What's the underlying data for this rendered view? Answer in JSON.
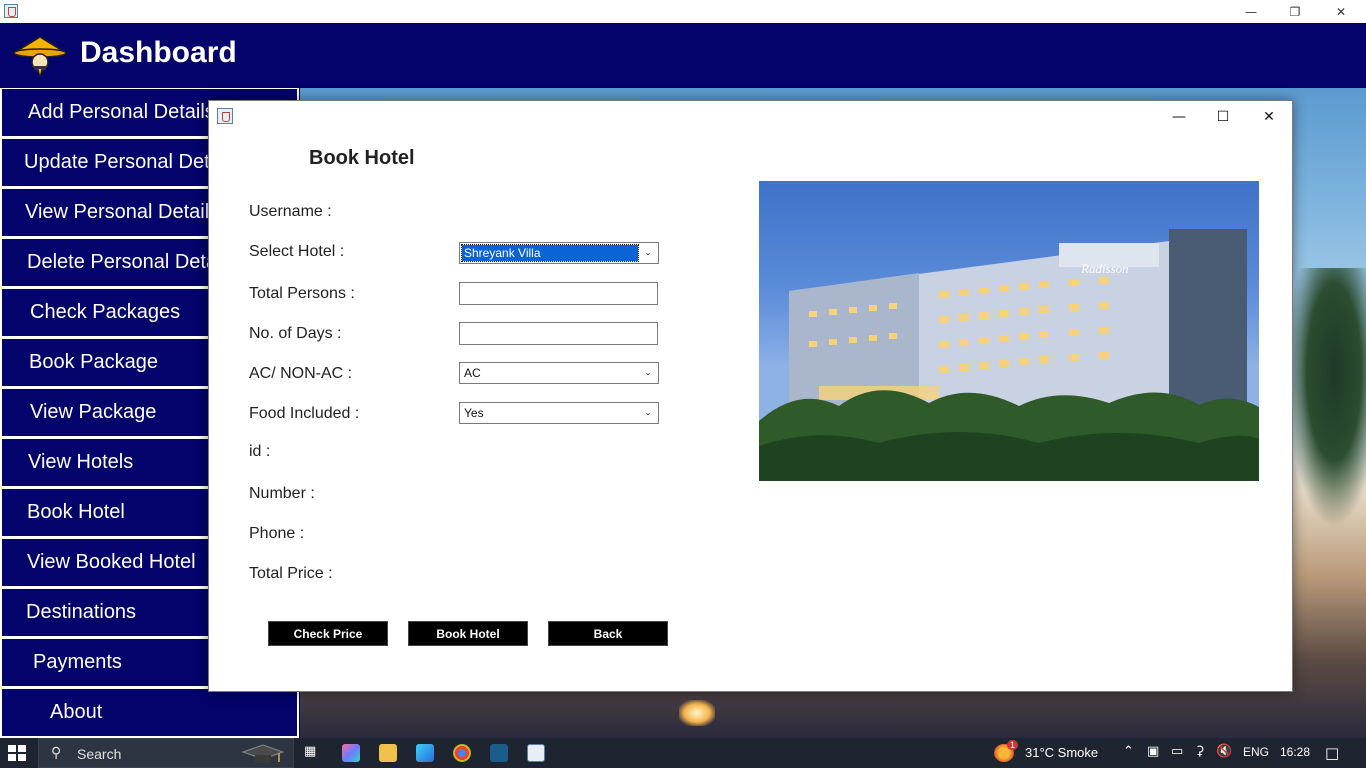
{
  "outer_window": {
    "minimize_glyph": "—",
    "restore_glyph": "❐",
    "close_glyph": "✕"
  },
  "header": {
    "title": "Dashboard"
  },
  "sidebar": {
    "items": [
      {
        "label": "Add Personal Details"
      },
      {
        "label": "Update Personal Details"
      },
      {
        "label": "View Personal Details"
      },
      {
        "label": "Delete Personal Details"
      },
      {
        "label": "Check Packages"
      },
      {
        "label": "Book Package"
      },
      {
        "label": "View Package"
      },
      {
        "label": "View Hotels"
      },
      {
        "label": "Book Hotel"
      },
      {
        "label": "View Booked Hotel"
      },
      {
        "label": "Destinations"
      },
      {
        "label": "Payments"
      },
      {
        "label": "About"
      }
    ]
  },
  "dialog": {
    "minimize_glyph": "—",
    "maximize_glyph": "☐",
    "close_glyph": "✕",
    "title": "Book Hotel",
    "labels": {
      "username": "Username :",
      "select_hotel": "Select Hotel :",
      "total_persons": "Total Persons :",
      "days": "No. of Days :",
      "ac": "AC/ NON-AC :",
      "food": "Food Included :",
      "id": "id :",
      "number": "Number :",
      "phone": "Phone :",
      "total_price": "Total Price :"
    },
    "fields": {
      "hotel": "Shreyank Villa",
      "total_persons": "",
      "days": "",
      "ac": "AC",
      "food": "Yes"
    },
    "buttons": {
      "check_price": "Check Price",
      "book_hotel": "Book Hotel",
      "back": "Back"
    },
    "photo_sign": "Radisson"
  },
  "taskbar": {
    "search_label": "Search",
    "weather_badge": "1",
    "weather": "31°C  Smoke",
    "language": "ENG",
    "time": "16:28"
  },
  "colors": {
    "navy": "#03036b",
    "selection": "#0a64d6",
    "button": "#000000",
    "taskbar": "#1f2530"
  }
}
